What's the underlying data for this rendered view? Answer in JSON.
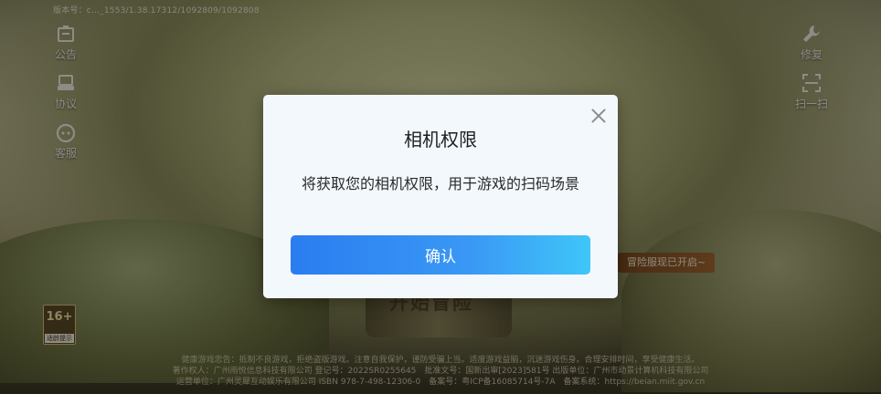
{
  "top": {
    "version_text": "版本号：c…_1553/1.38.17312/1092809/1092808"
  },
  "left_menu": [
    {
      "label": "公告",
      "icon": "notice-icon"
    },
    {
      "label": "协议",
      "icon": "agreement-icon"
    },
    {
      "label": "客服",
      "icon": "support-headset-icon"
    }
  ],
  "right_menu": [
    {
      "label": "修复",
      "icon": "wrench-icon"
    },
    {
      "label": "扫一扫",
      "icon": "scan-icon"
    }
  ],
  "age_badge": {
    "rating": "16+",
    "tip": "适龄提示"
  },
  "ribbon": "冒险服现已开启~",
  "start_button": "开始冒险",
  "footer": {
    "line1": "健康游戏忠告：抵制不良游戏，拒绝盗版游戏。注意自我保护，谨防受骗上当。适度游戏益脑，沉迷游戏伤身。合理安排时间，享受健康生活。",
    "line2": "著作权人：广州雨悦信息科技有限公司 登记号：2022SR0255645　批准文号：国新出审[2023]581号 出版单位：广州市动景计算机科技有限公司",
    "line3": "运营单位：广州灵犀互动娱乐有限公司 ISBN 978-7-498-12306-0　备案号：粤ICP备16085714号-7A　备案系统：https://beian.miit.gov.cn"
  },
  "dialog": {
    "title": "相机权限",
    "message": "将获取您的相机权限，用于游戏的扫码场景",
    "confirm_label": "确认",
    "close_icon": "close-icon"
  },
  "colors": {
    "dialog_bg": "#f3f8fd",
    "confirm_start": "#2a7df0",
    "confirm_end": "#3fc6f8"
  }
}
